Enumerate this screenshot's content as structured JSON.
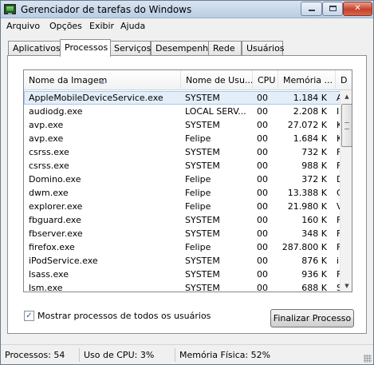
{
  "window": {
    "title": "Gerenciador de tarefas do Windows"
  },
  "titlebar_buttons": {
    "minimize": "minimize-icon",
    "maximize": "maximize-icon",
    "close_label": "✕"
  },
  "menu": [
    "Arquivo",
    "Opções",
    "Exibir",
    "Ajuda"
  ],
  "tabs": [
    "Aplicativos",
    "Processos",
    "Serviços",
    "Desempenho",
    "Rede",
    "Usuários"
  ],
  "active_tab": "Processos",
  "table": {
    "columns": [
      "Nome da Imagem",
      "Nome de Usu...",
      "CPU",
      "Memória ...",
      "D"
    ],
    "sort_indicator": "▲",
    "rows": [
      {
        "name": "AppleMobileDeviceService.exe",
        "user": "SYSTEM",
        "cpu": "00",
        "mem": "1.184 K",
        "desc": "A"
      },
      {
        "name": "audiodg.exe",
        "user": "LOCAL SERV...",
        "cpu": "00",
        "mem": "2.208 K",
        "desc": "I"
      },
      {
        "name": "avp.exe",
        "user": "SYSTEM",
        "cpu": "00",
        "mem": "27.072 K",
        "desc": "K"
      },
      {
        "name": "avp.exe",
        "user": "Felipe",
        "cpu": "00",
        "mem": "1.684 K",
        "desc": "K"
      },
      {
        "name": "csrss.exe",
        "user": "SYSTEM",
        "cpu": "00",
        "mem": "732 K",
        "desc": "F"
      },
      {
        "name": "csrss.exe",
        "user": "SYSTEM",
        "cpu": "00",
        "mem": "988 K",
        "desc": "F"
      },
      {
        "name": "Domino.exe",
        "user": "Felipe",
        "cpu": "00",
        "mem": "372 K",
        "desc": "D"
      },
      {
        "name": "dwm.exe",
        "user": "Felipe",
        "cpu": "00",
        "mem": "13.388 K",
        "desc": "C"
      },
      {
        "name": "explorer.exe",
        "user": "Felipe",
        "cpu": "00",
        "mem": "21.980 K",
        "desc": "V"
      },
      {
        "name": "fbguard.exe",
        "user": "SYSTEM",
        "cpu": "00",
        "mem": "160 K",
        "desc": "F"
      },
      {
        "name": "fbserver.exe",
        "user": "SYSTEM",
        "cpu": "00",
        "mem": "348 K",
        "desc": "F"
      },
      {
        "name": "firefox.exe",
        "user": "Felipe",
        "cpu": "00",
        "mem": "287.800 K",
        "desc": "F"
      },
      {
        "name": "iPodService.exe",
        "user": "SYSTEM",
        "cpu": "00",
        "mem": "876 K",
        "desc": "il"
      },
      {
        "name": "lsass.exe",
        "user": "SYSTEM",
        "cpu": "00",
        "mem": "936 K",
        "desc": "F"
      },
      {
        "name": "lsm.exe",
        "user": "SYSTEM",
        "cpu": "00",
        "mem": "688 K",
        "desc": "S"
      }
    ],
    "selected_row": 0
  },
  "scrollbar": {
    "up_icon": "▲",
    "down_icon": "▼"
  },
  "show_all_processes": {
    "label": "Mostrar processos de todos os usuários",
    "checked": true,
    "check_glyph": "✓"
  },
  "end_process_button": "Finalizar Processo",
  "status": {
    "processes": "Processos: 54",
    "cpu": "Uso de CPU: 3%",
    "memory": "Memória Física: 52%"
  }
}
